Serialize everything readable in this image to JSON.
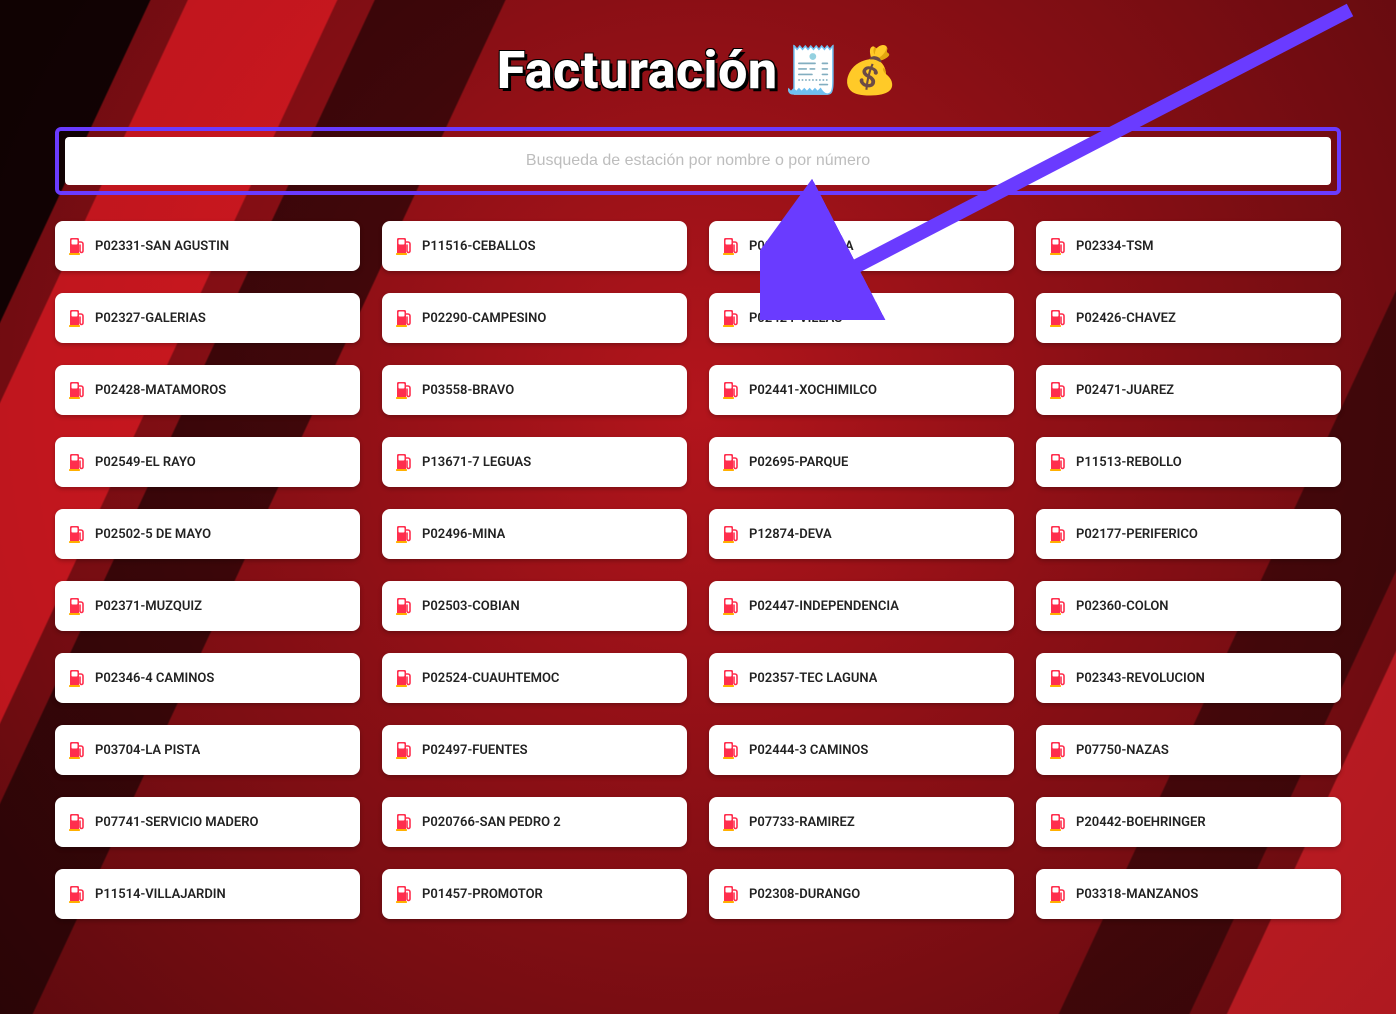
{
  "title": "Facturación",
  "search": {
    "placeholder": "Busqueda de estación por nombre o por número"
  },
  "annotation": {
    "highlight_color": "#6a3bff",
    "arrow_target": "P02424-VILLAS"
  },
  "stations": [
    "P02331-SAN AGUSTIN",
    "P11516-CEBALLOS",
    "P09455-SARABIA",
    "P02334-TSM",
    "P02327-GALERIAS",
    "P02290-CAMPESINO",
    "P02424-VILLAS",
    "P02426-CHAVEZ",
    "P02428-MATAMOROS",
    "P03558-BRAVO",
    "P02441-XOCHIMILCO",
    "P02471-JUAREZ",
    "P02549-EL RAYO",
    "P13671-7 LEGUAS",
    "P02695-PARQUE",
    "P11513-REBOLLO",
    "P02502-5 DE MAYO",
    "P02496-MINA",
    "P12874-DEVA",
    "P02177-PERIFERICO",
    "P02371-MUZQUIZ",
    "P02503-COBIAN",
    "P02447-INDEPENDENCIA",
    "P02360-COLON",
    "P02346-4 CAMINOS",
    "P02524-CUAUHTEMOC",
    "P02357-TEC LAGUNA",
    "P02343-REVOLUCION",
    "P03704-LA PISTA",
    "P02497-FUENTES",
    "P02444-3 CAMINOS",
    "P07750-NAZAS",
    "P07741-SERVICIO MADERO",
    "P020766-SAN PEDRO 2",
    "P07733-RAMIREZ",
    "P20442-BOEHRINGER",
    "P11514-VILLAJARDIN",
    "P01457-PROMOTOR",
    "P02308-DURANGO",
    "P03318-MANZANOS"
  ]
}
